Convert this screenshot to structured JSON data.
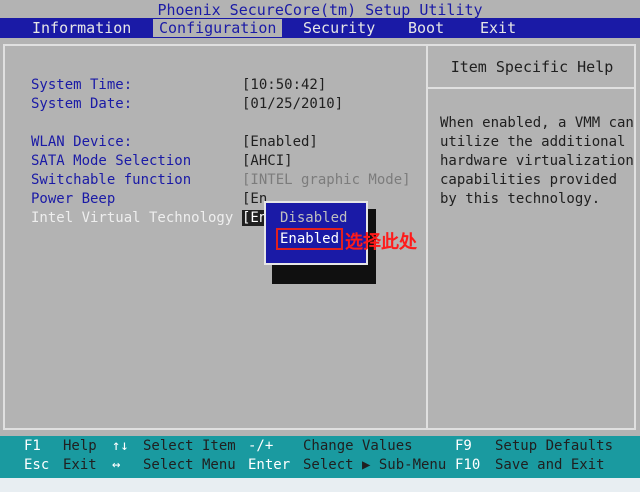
{
  "app": {
    "title": "Phoenix SecureCore(tm) Setup Utility"
  },
  "menu": [
    {
      "label": "Information"
    },
    {
      "label": "Configuration",
      "active": true
    },
    {
      "label": "Security"
    },
    {
      "label": "Boot"
    },
    {
      "label": "Exit"
    }
  ],
  "settings": {
    "system_time": {
      "label": "System Time:",
      "value": "[10:50:42]"
    },
    "system_date": {
      "label": "System Date:",
      "value": "[01/25/2010]"
    },
    "wlan": {
      "label": "WLAN Device:",
      "value": "[Enabled]"
    },
    "sata": {
      "label": "SATA Mode Selection",
      "value": "[AHCI]"
    },
    "switchable": {
      "label": "Switchable function",
      "value": "[INTEL graphic Mode]"
    },
    "power_beep": {
      "label": "Power Beep",
      "value": "[En"
    },
    "vt": {
      "label": "Intel Virtual Technology",
      "value": "[En"
    }
  },
  "help": {
    "title": "Item Specific Help",
    "lines": [
      "When enabled, a VMM can",
      "utilize the additional",
      "hardware virtualization",
      "capabilities provided",
      "by this technology."
    ]
  },
  "popup": {
    "options": [
      "Disabled",
      "Enabled"
    ],
    "selected": "Enabled"
  },
  "annotation": "选择此处",
  "footer": {
    "row1": {
      "k1": "F1",
      "d1": "Help",
      "k2": "↑↓",
      "d2": "Select Item",
      "k3": "-/+",
      "d3": "Change Values",
      "k4": "F9",
      "d4": "Setup Defaults"
    },
    "row2": {
      "k1": "Esc",
      "d1": "Exit",
      "k2": "↔",
      "d2": "Select Menu",
      "k3": "Enter",
      "d3": "Select ▶ Sub-Menu",
      "k4": "F10",
      "d4": "Save and Exit"
    }
  },
  "colors": {
    "bios_blue": "#1a1aa6",
    "grey_bg": "#b3b3b3",
    "footer_teal": "#1a9aa0",
    "annotation_red": "#ff1a1a"
  }
}
